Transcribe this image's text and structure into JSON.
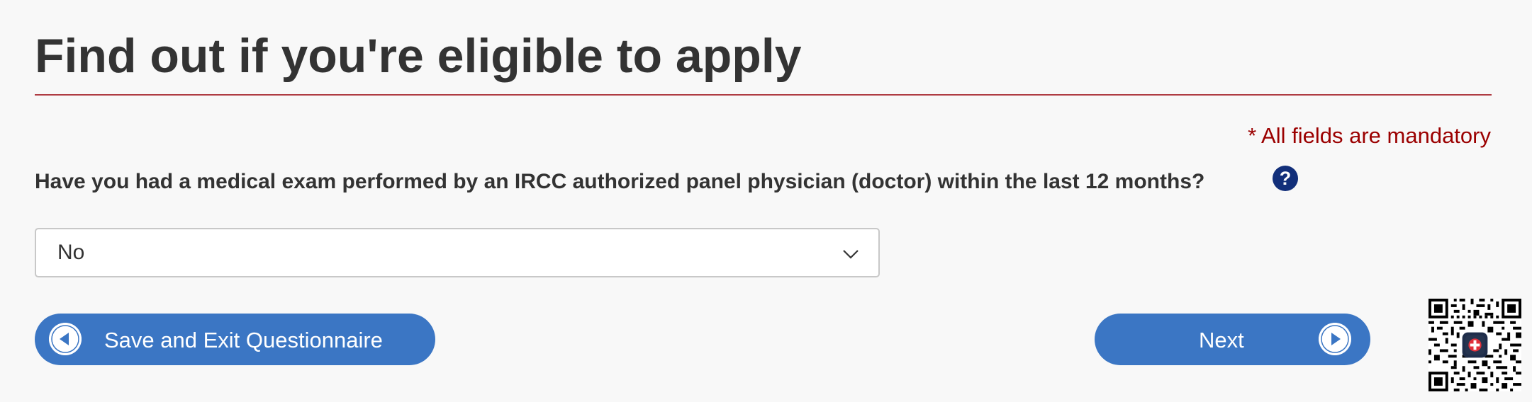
{
  "page": {
    "title": "Find out if you're eligible to apply",
    "mandatory_note": "* All fields are mandatory"
  },
  "question": {
    "text": "Have you had a medical exam performed by an IRCC authorized panel physician (doctor) within the last 12 months?",
    "help_icon_glyph": "?",
    "selected_value": "No"
  },
  "buttons": {
    "save_exit_label": "Save and Exit Questionnaire",
    "next_label": "Next"
  },
  "icons": {
    "help": "question-circle-icon",
    "dropdown": "chevron-down-icon",
    "back": "circle-arrow-left-icon",
    "forward": "circle-arrow-right-icon",
    "qr": "qr-code"
  },
  "colors": {
    "background": "#f8f8f8",
    "title_rule": "#af3c43",
    "mandatory_text": "#9b0000",
    "help_icon": "#122f7a",
    "button": "#3b76c4"
  }
}
